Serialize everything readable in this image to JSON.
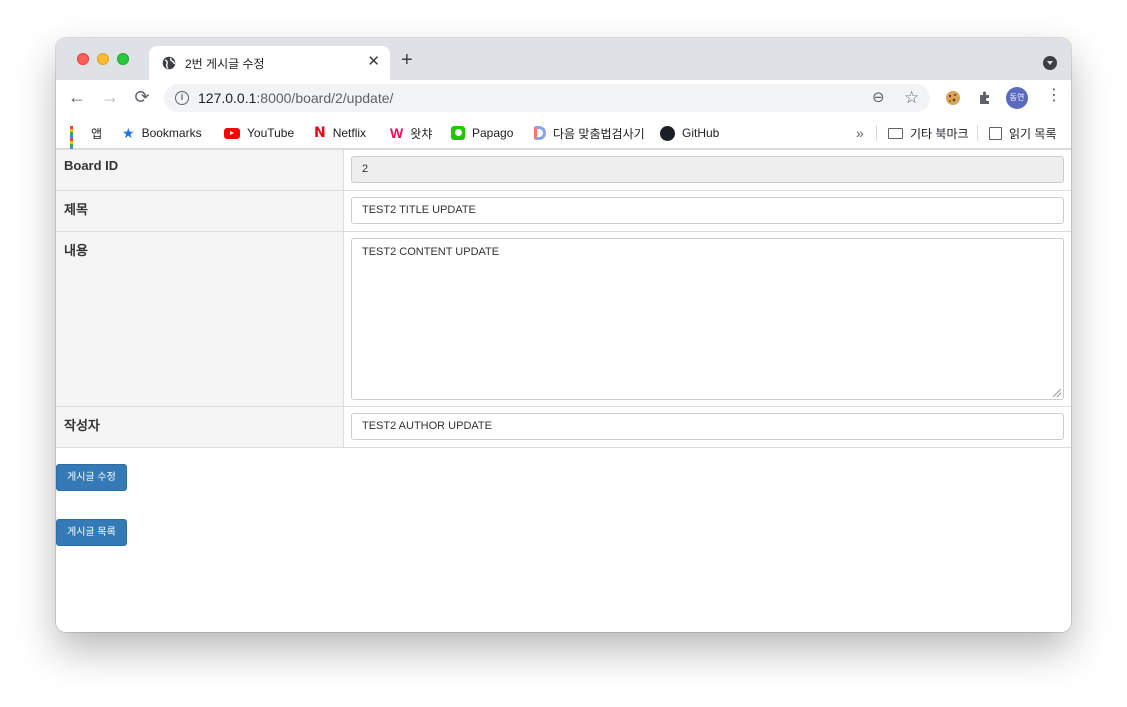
{
  "tab": {
    "title": "2번 게시글 수정",
    "close": "✕",
    "new_tab": "+"
  },
  "toolbar": {
    "back": "←",
    "forward": "→",
    "reload": "⟳",
    "url_host": "127.0.0.1",
    "url_rest": ":8000/board/2/update/",
    "zoom": "⊖",
    "star": "☆",
    "profile_initials": "동연",
    "menu": "⋮"
  },
  "bookmarks": {
    "apps": "앱",
    "items": [
      "Bookmarks",
      "YouTube",
      "Netflix",
      "왓챠",
      "Papago",
      "다음 맞춤법검사기",
      "GitHub"
    ],
    "overflow": "»",
    "other": "기타 북마크",
    "reading_list": "읽기 목록"
  },
  "form": {
    "rows": [
      {
        "label": "Board ID",
        "value": "2"
      },
      {
        "label": "제목",
        "value": "TEST2 TITLE UPDATE"
      },
      {
        "label": "내용",
        "value": "TEST2 CONTENT UPDATE"
      },
      {
        "label": "작성자",
        "value": "TEST2 AUTHOR UPDATE"
      }
    ],
    "submit_label": "게시글 수정",
    "list_label": "게시글 목록"
  },
  "colors": {
    "primary_button": "#337ab7",
    "label_bg": "#f5f5f5",
    "readonly_bg": "#eeeeee"
  }
}
